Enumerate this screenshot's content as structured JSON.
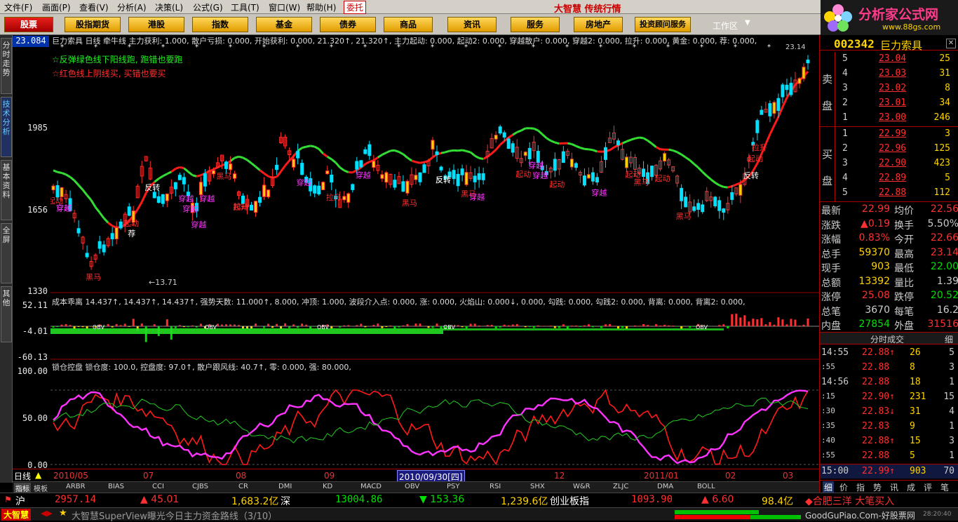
{
  "menu": [
    "文件(F)",
    "画面(P)",
    "查看(V)",
    "分析(A)",
    "决策(L)",
    "公式(G)",
    "工具(T)",
    "窗口(W)",
    "帮助(H)",
    "委托"
  ],
  "brand": "大智慧 传统行情",
  "toolbar": [
    "股票",
    "股指期货",
    "港股",
    "指数",
    "基金",
    "债券",
    "商品",
    "资讯",
    "服务",
    "房地产",
    "投资顾问服务"
  ],
  "workspace": "工作区",
  "logo": {
    "line1": "分析家公式网",
    "line2": "www.88gs.com"
  },
  "left_tabs": [
    "分时走势",
    "技术分析",
    "基本资料",
    "全屏",
    "其他"
  ],
  "main": {
    "price_label": "23.084",
    "title_line": "巨力索具 日线 牵牛线 主力获利: 1.000, 散户亏损: 0.000, 开始获利: 0.000, 21.320↑, 21.320↑, 主力起动: 0.000, 起动2: 0.000, 穿越散户: 0.000, 穿越2: 0.000, 拉升: 0.000, 黄金: 0.000, 荐: 0.000,",
    "note1": "☆反弹绿色线下阳线跑, 跑错也要跑",
    "note2": "☆红色线上阴线买, 买错也要买",
    "y_labels": [
      "1985",
      "1656",
      "1330"
    ],
    "low_annotation": "←13.71",
    "high_annotation": "23.14",
    "chart_tags": [
      "反转",
      "荐",
      "起动",
      "拉升",
      "穿越",
      "黑马"
    ]
  },
  "panel2": {
    "title": "成本乖离 14.437↑, 14.437↑, 14.437↑, 强势天数: 11.000↑, 8.000, 冲顶: 1.000, 波段介入点: 0.000, 涨: 0.000, 火焰山: 0.000↓, 0.000, 勾践: 0.000, 勾践2: 0.000, 背离: 0.000, 背离2: 0.000,",
    "y_labels": [
      "52.11",
      "-4.01",
      "-60.13"
    ],
    "tag": "OBV"
  },
  "panel3": {
    "title": "锁仓控盘 锁仓度: 100.0, 控盘度: 97.0↑, 散户跟风线: 40.7↑, 零: 0.000, 强: 80.000,",
    "y_labels": [
      "100.00",
      "50.00",
      "0.00"
    ]
  },
  "dates": {
    "period": "日线",
    "items": [
      "2010/05",
      "07",
      "08",
      "09",
      "2010/09/30[四]",
      "12",
      "2011/01",
      "02",
      "03"
    ]
  },
  "indicators": [
    "指标",
    "模板",
    "ARBR",
    "BIAS",
    "CCI",
    "CJBS",
    "CR",
    "DMI",
    "KD",
    "MACD",
    "OBV",
    "PSY",
    "RSI",
    "SHX",
    "W&R",
    "ZLJC",
    "DMA",
    "BOLL"
  ],
  "quote": {
    "code": "002342",
    "name": "巨力索具",
    "ask_label": "卖盘",
    "bid_label": "买盘",
    "asks": [
      [
        "5",
        "23.04",
        "25"
      ],
      [
        "4",
        "23.03",
        "31"
      ],
      [
        "3",
        "23.02",
        "8"
      ],
      [
        "2",
        "23.01",
        "34"
      ],
      [
        "1",
        "23.00",
        "246"
      ]
    ],
    "bids": [
      [
        "1",
        "22.99",
        "3"
      ],
      [
        "2",
        "22.96",
        "125"
      ],
      [
        "3",
        "22.90",
        "423"
      ],
      [
        "4",
        "22.89",
        "5"
      ],
      [
        "5",
        "22.88",
        "112"
      ]
    ],
    "stats": [
      [
        "最新",
        "22.99",
        "均价",
        "22.56"
      ],
      [
        "涨跌",
        "▲0.19",
        "换手",
        "5.50%"
      ],
      [
        "涨幅",
        "0.83%",
        "今开",
        "22.66"
      ],
      [
        "总手",
        "59370",
        "最高",
        "23.14"
      ],
      [
        "现手",
        "903",
        "最低",
        "22.00"
      ],
      [
        "总额",
        "13392",
        "量比",
        "1.39"
      ],
      [
        "涨停",
        "25.08",
        "跌停",
        "20.52"
      ],
      [
        "总笔",
        "3670",
        "每笔",
        "16.2"
      ],
      [
        "内盘",
        "27854",
        "外盘",
        "31516"
      ]
    ],
    "ticks_header": "分时成交",
    "ticks_tab": "细",
    "ticks": [
      [
        "14:55",
        "22.88↑",
        "26",
        "5"
      ],
      [
        ":55",
        "22.88",
        "8",
        "3"
      ],
      [
        "14:56",
        "22.88",
        "18",
        "1"
      ],
      [
        ":15",
        "22.90↑",
        "231",
        "15"
      ],
      [
        ":30",
        "22.83↓",
        "31",
        "4"
      ],
      [
        ":35",
        "22.83",
        "9",
        "1"
      ],
      [
        ":40",
        "22.88↑",
        "15",
        "3"
      ],
      [
        ":55",
        "22.88",
        "5",
        "1"
      ],
      [
        "15:00",
        "22.99↑",
        "903",
        "70"
      ]
    ],
    "bottom_tabs": [
      "细",
      "价",
      "指",
      "势",
      "讯",
      "成",
      "评",
      "笔"
    ]
  },
  "status": {
    "sh_label": "沪",
    "sh_index": "2957.14",
    "sh_change": "▲ 45.01",
    "sh_amount": "1,683.2亿",
    "sz_label": "深",
    "sz_index": "13004.86",
    "sz_change": "▼ 153.36",
    "sz_amount": "1,239.6亿",
    "cy_label": "创业板指",
    "cy_index": "1093.90",
    "cy_change": "▲ 6.60",
    "cy_amount": "98.4亿",
    "ticker": "大智慧SuperView曝光今日主力资金路线（3/10）",
    "news": "◆合肥三洋 大笔买入",
    "app": "大智慧",
    "time": "28:20:40",
    "watermark": "GoodGuPiao.Com-好股票网"
  },
  "colors": {
    "up": "#ff3030",
    "down": "#00e0ff",
    "green_line": "#33dd33",
    "red_line": "#ff1a1a",
    "magenta": "#ff33ff"
  }
}
